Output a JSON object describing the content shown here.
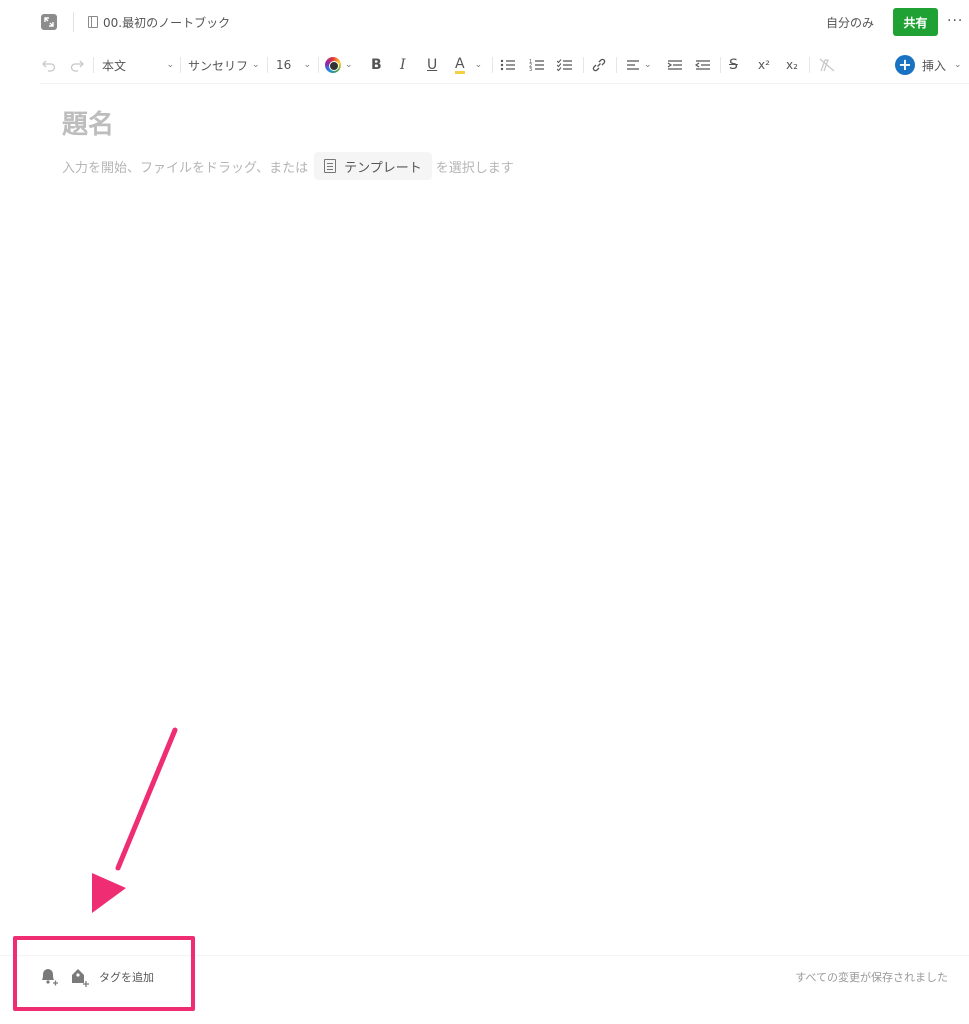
{
  "topbar": {
    "expand_icon": "expand-icon",
    "notebook_name": "00.最初のノートブック",
    "visibility": "自分のみ",
    "share_label": "共有",
    "more_label": "···"
  },
  "toolbar": {
    "undo_icon": "undo-icon",
    "redo_icon": "redo-icon",
    "paragraph_style": "本文",
    "font_family": "サンセリフ",
    "font_size": "16",
    "bold": "B",
    "italic": "I",
    "underline": "U",
    "highlight": "A",
    "superscript": "x²",
    "subscript": "x₂",
    "insert_label": "挿入"
  },
  "editor": {
    "title_placeholder": "題名",
    "hint_before": "入力を開始、ファイルをドラッグ、または",
    "template_label": "テンプレート",
    "hint_after": "を選択します"
  },
  "footer": {
    "add_tag_label": "タグを追加",
    "save_status": "すべての変更が保存されました"
  },
  "colors": {
    "share_green": "#1fa133",
    "insert_blue": "#1a73c2",
    "annotation_pink": "#ef2d73"
  }
}
